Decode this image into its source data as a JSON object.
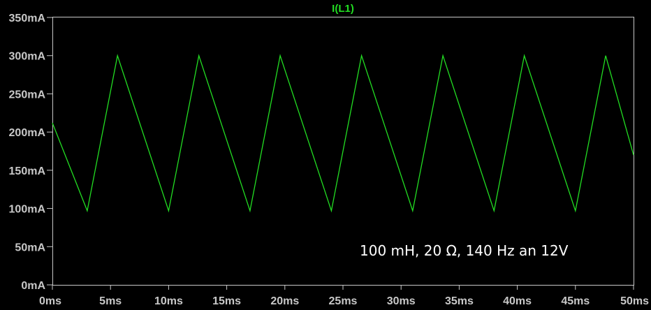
{
  "chart_data": {
    "type": "line",
    "title": "I(L1)",
    "xlabel": "",
    "ylabel": "",
    "xlim": [
      0,
      50
    ],
    "ylim": [
      0,
      350
    ],
    "x_unit": "ms",
    "y_unit": "mA",
    "x_ticks": [
      "0ms",
      "5ms",
      "10ms",
      "15ms",
      "20ms",
      "25ms",
      "30ms",
      "35ms",
      "40ms",
      "45ms",
      "50ms"
    ],
    "y_ticks": [
      "0mA",
      "50mA",
      "100mA",
      "150mA",
      "200mA",
      "250mA",
      "300mA",
      "350mA"
    ],
    "grid": false,
    "annotation": "100 mH, 20 Ω, 140 Hz an 12V",
    "colors": {
      "background": "#000000",
      "trace": "#22dd22",
      "axis": "#c8c8c8",
      "title": "#22dd22"
    },
    "series": [
      {
        "name": "I(L1)",
        "x": [
          0,
          3.0,
          5.6,
          10.0,
          12.6,
          17.0,
          19.6,
          24.0,
          26.6,
          31.0,
          33.6,
          38.0,
          40.6,
          45.0,
          47.6,
          50.0
        ],
        "y": [
          212,
          97,
          300,
          97,
          300,
          97,
          300,
          97,
          300,
          97,
          300,
          97,
          300,
          97,
          300,
          170
        ]
      }
    ]
  }
}
